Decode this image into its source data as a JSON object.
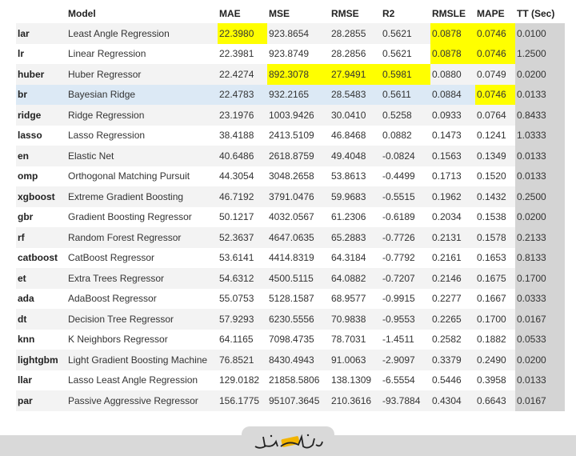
{
  "table": {
    "headers": [
      "",
      "Model",
      "MAE",
      "MSE",
      "RMSE",
      "R2",
      "RMSLE",
      "MAPE",
      "TT (Sec)"
    ],
    "rows": [
      {
        "id": "lar",
        "model": "Least Angle Regression",
        "mae": "22.3980",
        "mse": "923.8654",
        "rmse": "28.2855",
        "r2": "0.5621",
        "rmsle": "0.0878",
        "mape": "0.0746",
        "tt": "0.0100",
        "hl": [
          "mae",
          "rmsle",
          "mape"
        ]
      },
      {
        "id": "lr",
        "model": "Linear Regression",
        "mae": "22.3981",
        "mse": "923.8749",
        "rmse": "28.2856",
        "r2": "0.5621",
        "rmsle": "0.0878",
        "mape": "0.0746",
        "tt": "1.2500",
        "hl": [
          "rmsle",
          "mape"
        ]
      },
      {
        "id": "huber",
        "model": "Huber Regressor",
        "mae": "22.4274",
        "mse": "892.3078",
        "rmse": "27.9491",
        "r2": "0.5981",
        "rmsle": "0.0880",
        "mape": "0.0749",
        "tt": "0.0200",
        "hl": [
          "mse",
          "rmse",
          "r2"
        ]
      },
      {
        "id": "br",
        "model": "Bayesian Ridge",
        "mae": "22.4783",
        "mse": "932.2165",
        "rmse": "28.5483",
        "r2": "0.5611",
        "rmsle": "0.0884",
        "mape": "0.0746",
        "tt": "0.0133",
        "hl": [
          "mape"
        ],
        "selected": true
      },
      {
        "id": "ridge",
        "model": "Ridge Regression",
        "mae": "23.1976",
        "mse": "1003.9426",
        "rmse": "30.0410",
        "r2": "0.5258",
        "rmsle": "0.0933",
        "mape": "0.0764",
        "tt": "0.8433",
        "hl": []
      },
      {
        "id": "lasso",
        "model": "Lasso Regression",
        "mae": "38.4188",
        "mse": "2413.5109",
        "rmse": "46.8468",
        "r2": "0.0882",
        "rmsle": "0.1473",
        "mape": "0.1241",
        "tt": "1.0333",
        "hl": []
      },
      {
        "id": "en",
        "model": "Elastic Net",
        "mae": "40.6486",
        "mse": "2618.8759",
        "rmse": "49.4048",
        "r2": "-0.0824",
        "rmsle": "0.1563",
        "mape": "0.1349",
        "tt": "0.0133",
        "hl": []
      },
      {
        "id": "omp",
        "model": "Orthogonal Matching Pursuit",
        "mae": "44.3054",
        "mse": "3048.2658",
        "rmse": "53.8613",
        "r2": "-0.4499",
        "rmsle": "0.1713",
        "mape": "0.1520",
        "tt": "0.0133",
        "hl": []
      },
      {
        "id": "xgboost",
        "model": "Extreme Gradient Boosting",
        "mae": "46.7192",
        "mse": "3791.0476",
        "rmse": "59.9683",
        "r2": "-0.5515",
        "rmsle": "0.1962",
        "mape": "0.1432",
        "tt": "0.2500",
        "hl": []
      },
      {
        "id": "gbr",
        "model": "Gradient Boosting Regressor",
        "mae": "50.1217",
        "mse": "4032.0567",
        "rmse": "61.2306",
        "r2": "-0.6189",
        "rmsle": "0.2034",
        "mape": "0.1538",
        "tt": "0.0200",
        "hl": []
      },
      {
        "id": "rf",
        "model": "Random Forest Regressor",
        "mae": "52.3637",
        "mse": "4647.0635",
        "rmse": "65.2883",
        "r2": "-0.7726",
        "rmsle": "0.2131",
        "mape": "0.1578",
        "tt": "0.2133",
        "hl": []
      },
      {
        "id": "catboost",
        "model": "CatBoost Regressor",
        "mae": "53.6141",
        "mse": "4414.8319",
        "rmse": "64.3184",
        "r2": "-0.7792",
        "rmsle": "0.2161",
        "mape": "0.1653",
        "tt": "0.8133",
        "hl": []
      },
      {
        "id": "et",
        "model": "Extra Trees Regressor",
        "mae": "54.6312",
        "mse": "4500.5115",
        "rmse": "64.0882",
        "r2": "-0.7207",
        "rmsle": "0.2146",
        "mape": "0.1675",
        "tt": "0.1700",
        "hl": []
      },
      {
        "id": "ada",
        "model": "AdaBoost Regressor",
        "mae": "55.0753",
        "mse": "5128.1587",
        "rmse": "68.9577",
        "r2": "-0.9915",
        "rmsle": "0.2277",
        "mape": "0.1667",
        "tt": "0.0333",
        "hl": []
      },
      {
        "id": "dt",
        "model": "Decision Tree Regressor",
        "mae": "57.9293",
        "mse": "6230.5556",
        "rmse": "70.9838",
        "r2": "-0.9553",
        "rmsle": "0.2265",
        "mape": "0.1700",
        "tt": "0.0167",
        "hl": []
      },
      {
        "id": "knn",
        "model": "K Neighbors Regressor",
        "mae": "64.1165",
        "mse": "7098.4735",
        "rmse": "78.7031",
        "r2": "-1.4511",
        "rmsle": "0.2582",
        "mape": "0.1882",
        "tt": "0.0533",
        "hl": []
      },
      {
        "id": "lightgbm",
        "model": "Light Gradient Boosting Machine",
        "mae": "76.8521",
        "mse": "8430.4943",
        "rmse": "91.0063",
        "r2": "-2.9097",
        "rmsle": "0.3379",
        "mape": "0.2490",
        "tt": "0.0200",
        "hl": []
      },
      {
        "id": "llar",
        "model": "Lasso Least Angle Regression",
        "mae": "129.0182",
        "mse": "21858.5806",
        "rmse": "138.1309",
        "r2": "-6.5554",
        "rmsle": "0.5446",
        "mape": "0.3958",
        "tt": "0.0133",
        "hl": []
      },
      {
        "id": "par",
        "model": "Passive Aggressive Regressor",
        "mae": "156.1775",
        "mse": "95107.3645",
        "rmse": "210.3616",
        "r2": "-93.7884",
        "rmsle": "0.4304",
        "mape": "0.6643",
        "tt": "0.0167",
        "hl": []
      }
    ]
  },
  "colors": {
    "highlight": "#ffff00",
    "selected_row": "#dce9f5",
    "tt_column": "#d4d4d4",
    "stripe": "#f3f3f3"
  },
  "footer": {
    "logo_icon": "calligraphy-logo-icon"
  }
}
